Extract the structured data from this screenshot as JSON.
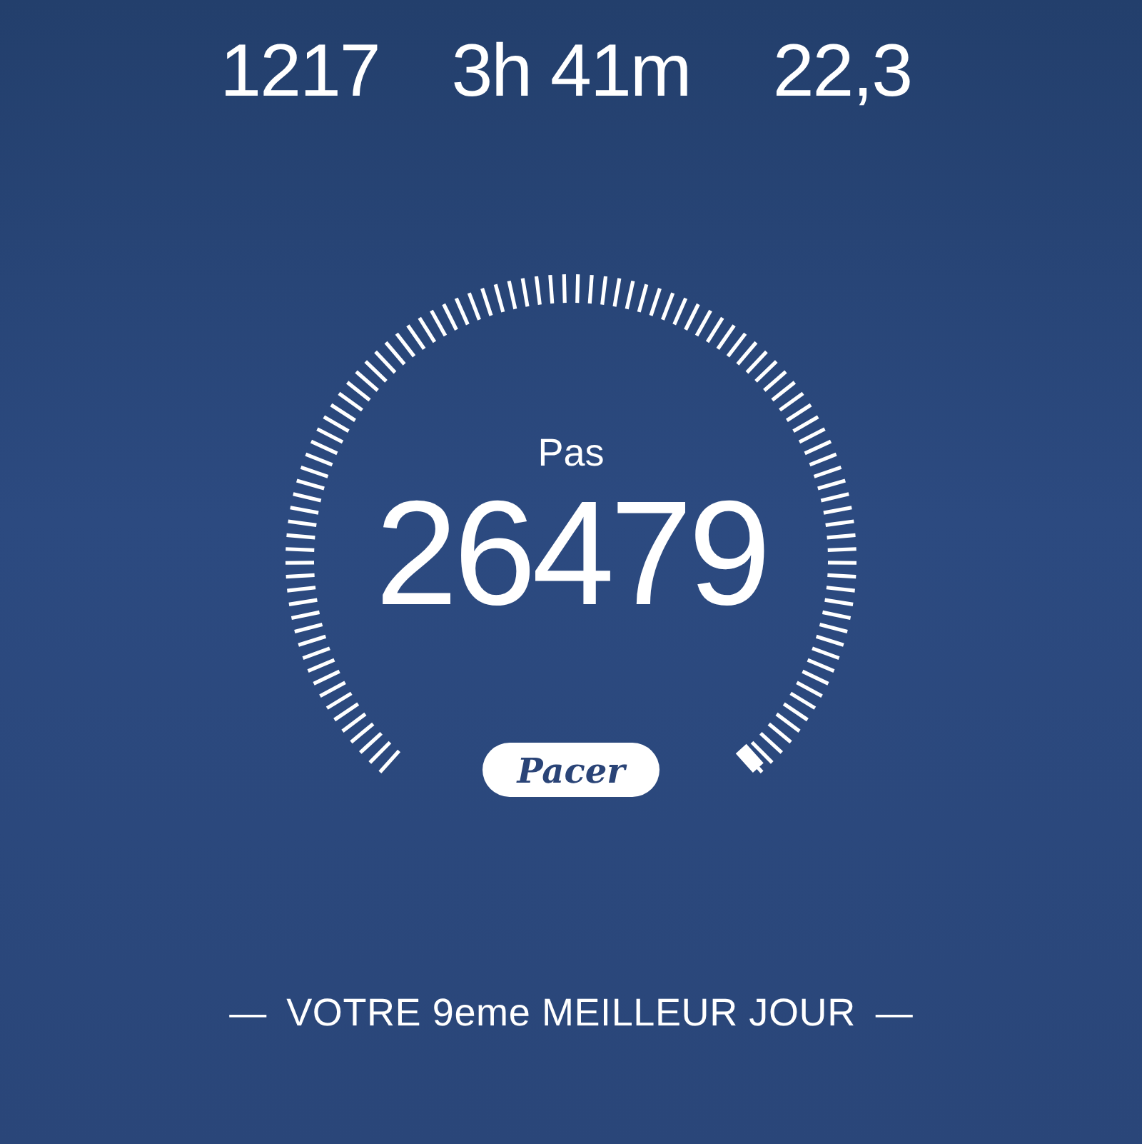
{
  "stats": [
    {
      "value": "1217"
    },
    {
      "value": "3h 41m"
    },
    {
      "value": "22,3"
    }
  ],
  "gauge": {
    "label": "Pas",
    "value": "26479"
  },
  "logo": {
    "text": "Pacer"
  },
  "footer": {
    "dash": "—",
    "text": "VOTRE 9eme MEILLEUR JOUR"
  }
}
